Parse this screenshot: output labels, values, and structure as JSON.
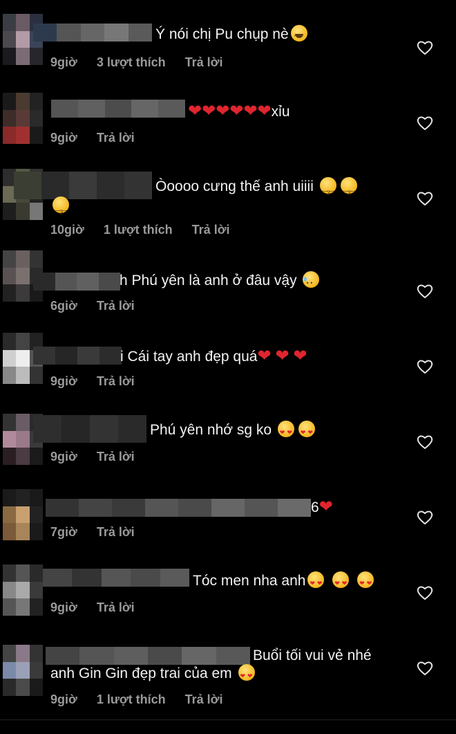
{
  "comments": [
    {
      "text": "Ý nói chị Pu chụp nè",
      "emoji_after": [
        "laugh-emoji"
      ],
      "time": "9giờ",
      "likes": "3 lượt thích",
      "reply": "Trả lời"
    },
    {
      "text": "xỉu",
      "emoji_before": [
        "heart",
        "heart",
        "heart",
        "heart",
        "heart",
        "heart"
      ],
      "time": "9giờ",
      "reply": "Trả lời"
    },
    {
      "text": "Òoooo cưng thế anh uiiii",
      "emoji_after": [
        "kiss-emoji",
        "kiss-emoji"
      ],
      "emoji_line2": [
        "kiss-emoji"
      ],
      "time": "10giờ",
      "likes": "1 lượt thích",
      "reply": "Trả lời"
    },
    {
      "text": "h Phú yên là anh ở đâu vậy",
      "emoji_after": [
        "tear-emoji"
      ],
      "time": "6giờ",
      "reply": "Trả lời"
    },
    {
      "text": "i Cái tay anh đẹp quá",
      "emoji_after": [
        "heart",
        "heart",
        "heart"
      ],
      "time": "9giờ",
      "reply": "Trả lời"
    },
    {
      "text": "Phú  yên  nhớ  sg ko",
      "emoji_after": [
        "love-emoji",
        "love-emoji"
      ],
      "time": "9giờ",
      "reply": "Trả lời"
    },
    {
      "text": "6",
      "emoji_after": [
        "heart"
      ],
      "time": "7giờ",
      "reply": "Trả lời"
    },
    {
      "text": "Tóc men nha anh",
      "emoji_after": [
        "love-emoji",
        "love-emoji",
        "love-emoji"
      ],
      "time": "9giờ",
      "reply": "Trả lời"
    },
    {
      "text": "Buổi tối vui vẻ nhé",
      "text_line2": "anh Gin Gin đẹp trai của em",
      "emoji_line2": [
        "love-emoji"
      ],
      "time": "9giờ",
      "likes": "1 lượt thích",
      "reply": "Trả lời"
    }
  ],
  "icons": {
    "like": "heart-outline-icon"
  },
  "colors": {
    "background": "#000000",
    "text": "#f2f2f2",
    "meta": "#9a9a9a",
    "heart": "#e0252e"
  }
}
